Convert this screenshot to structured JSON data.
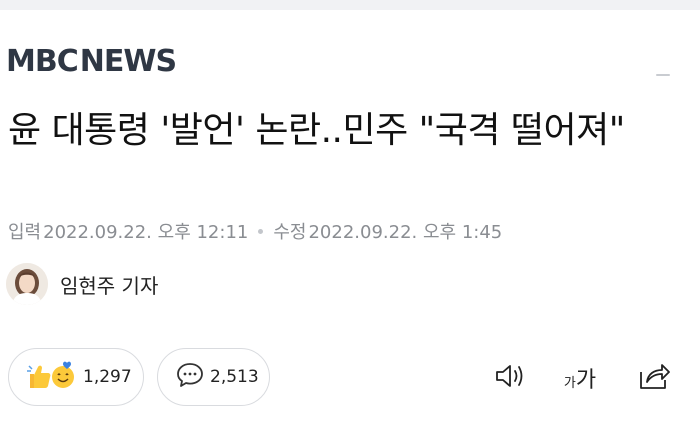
{
  "brand": {
    "logo_part1": "MBC",
    "logo_part2": "NEWS",
    "color": "#2f3744"
  },
  "article": {
    "title": "윤 대통령 '발언' 논란..민주 \"국격 떨어져\"",
    "published_label": "입력",
    "published_at": "2022.09.22. 오후 12:11",
    "modified_label": "수정",
    "modified_at": "2022.09.22. 오후 1:45",
    "reporter": "임현주 기자"
  },
  "reactions": {
    "like_count": "1,297",
    "comment_count": "2,513"
  },
  "tools": {
    "font_small": "가",
    "font_big": "가"
  },
  "icons": [
    "like-emoji-icon",
    "smile-emoji-icon",
    "comment-bubble-icon",
    "speaker-icon",
    "share-icon"
  ]
}
